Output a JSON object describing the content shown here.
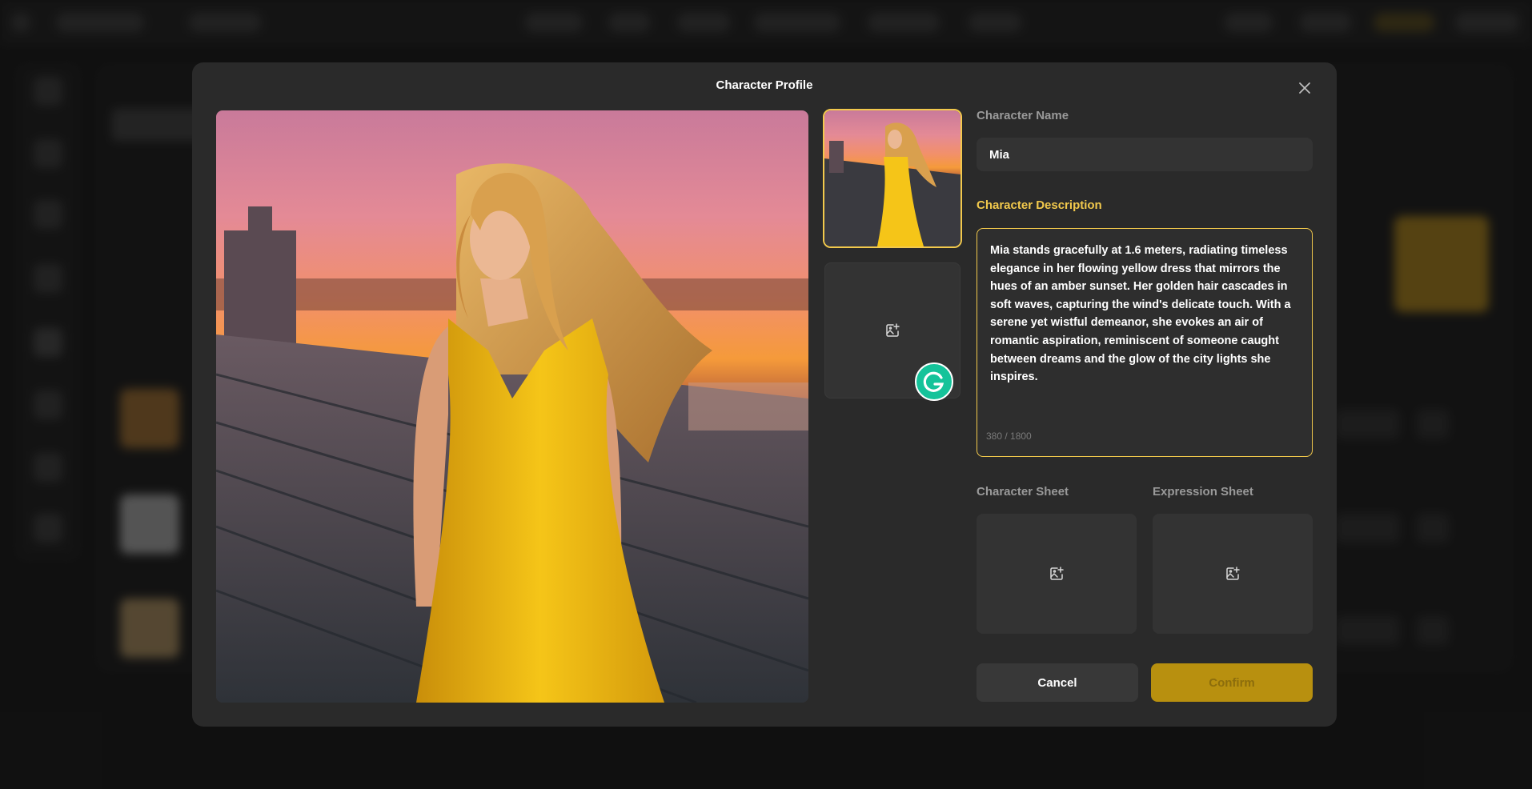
{
  "modal": {
    "title": "Character Profile",
    "close_icon": "close-icon"
  },
  "images": {
    "main_alt": "Woman in yellow dress on rooftop at sunset",
    "upload_icon": "image-plus-icon"
  },
  "fields": {
    "name_label": "Character Name",
    "name_value": "Mia",
    "description_label": "Character Description",
    "description_value": "Mia stands gracefully at 1.6 meters, radiating timeless elegance in her flowing yellow dress that mirrors the hues of an amber sunset. Her golden hair cascades in soft waves, capturing the wind's delicate touch. With a serene yet wistful demeanor, she evokes an air of romantic aspiration, reminiscent of someone caught between dreams and the glow of the city lights she inspires.",
    "description_count": "380 / 1800",
    "character_sheet_label": "Character Sheet",
    "expression_sheet_label": "Expression Sheet"
  },
  "buttons": {
    "cancel": "Cancel",
    "confirm": "Confirm"
  },
  "colors": {
    "accent": "#f2c94c",
    "confirm_bg": "#b8900f",
    "modal_bg": "#2a2a2a"
  }
}
